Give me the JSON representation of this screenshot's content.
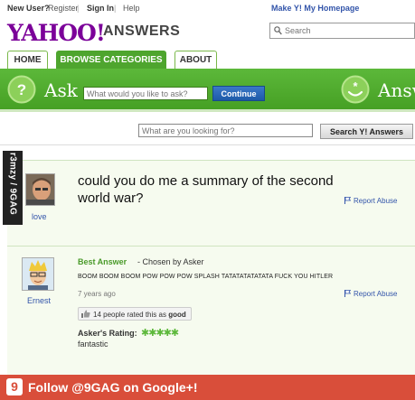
{
  "topbar": {
    "new_user": "New User?",
    "register": "Register",
    "sign_in": "Sign In",
    "help": "Help",
    "make_homepage": "Make Y! My Homepage"
  },
  "header": {
    "logo_text": "YAHOO",
    "logo_exclaim": "!",
    "section": "ANSWERS",
    "search_placeholder": "Search"
  },
  "tabs": [
    {
      "label": "HOME"
    },
    {
      "label": "BROWSE CATEGORIES"
    },
    {
      "label": "ABOUT"
    }
  ],
  "askbar": {
    "ask_label": "Ask",
    "input_placeholder": "What would you like to ask?",
    "continue_label": "Continue",
    "right_label": "Answ"
  },
  "search2": {
    "placeholder": "What are you looking for?",
    "button_label": "Search Y! Answers"
  },
  "watermark": "r3mzy / 9GAG",
  "question": {
    "text": "could you do me a summary of the second world war?",
    "user": "love",
    "report": "Report Abuse"
  },
  "answer": {
    "best_label": "Best Answer",
    "chosen": "- Chosen by Asker",
    "text": "BOOM BOOM BOOM POW POW POW SPLASH TATATATATATATA  FUCK YOU HITLER",
    "time": "7 years ago",
    "user": "Ernest",
    "report": "Report Abuse",
    "rated_count": "14 people rated this as",
    "rated_value": "good",
    "rating_label": "Asker's Rating:",
    "rating_stars": 5,
    "rating_text": "fantastic"
  },
  "footer": {
    "logo": "9",
    "text": "Follow @9GAG on Google+!"
  },
  "colors": {
    "brand_purple": "#7b0099",
    "ask_green": "#4ea52e",
    "link_blue": "#3355aa",
    "footer_red": "#d94e3a"
  }
}
